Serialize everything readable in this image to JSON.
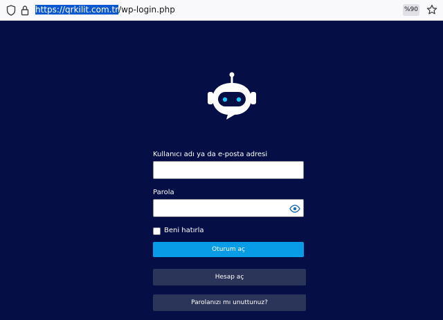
{
  "browser": {
    "url_selected": "https://qrkilit.com.tr",
    "url_rest": "/wp-login.php",
    "zoom": "%90"
  },
  "login": {
    "username_label": "Kullanıcı adı ya da e-posta adresi",
    "username_value": "",
    "password_label": "Parola",
    "password_value": "",
    "remember_label": "Beni hatırla",
    "remember_checked": false,
    "submit_label": "Oturum aç",
    "register_label": "Hesap aç",
    "lost_password_label": "Parolanızı mı unuttunuz?"
  },
  "icons": {
    "shield": "shield-icon",
    "lock": "lock-icon",
    "star": "bookmark-star-icon",
    "logo": "robot-chat-logo",
    "eye": "eye-icon"
  },
  "colors": {
    "background": "#050f45",
    "primary_button": "#089be6",
    "secondary_button": "#2a3559",
    "logo_eyes": "#27c5ee"
  }
}
